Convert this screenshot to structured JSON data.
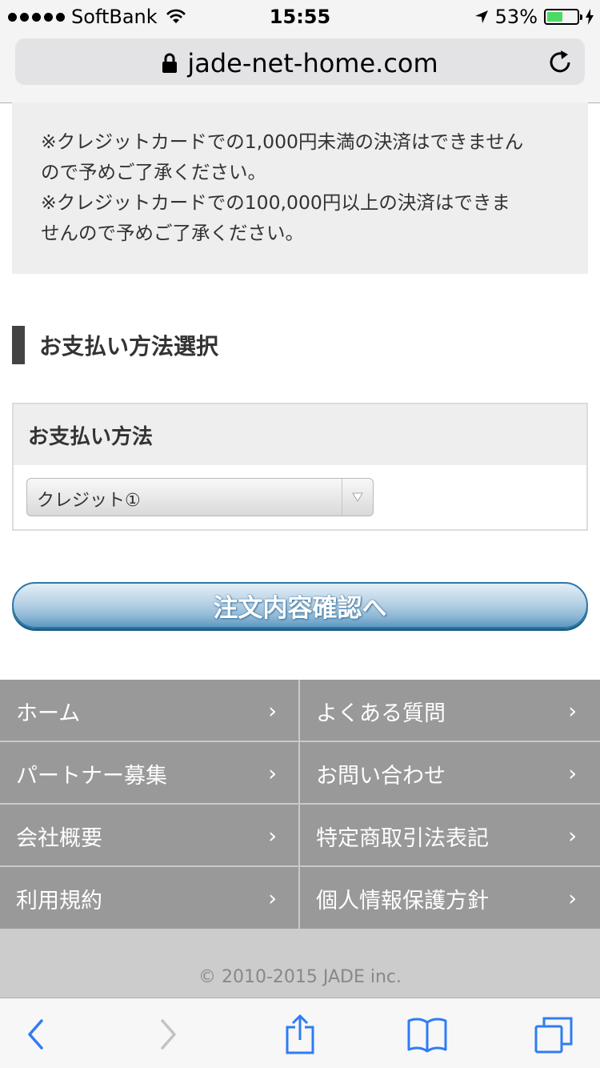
{
  "status_bar": {
    "carrier": "SoftBank",
    "time": "15:55",
    "battery_percent_label": "53%",
    "battery_level": 0.53
  },
  "url_bar": {
    "url": "jade-net-home.com"
  },
  "notice": {
    "line1": "※クレジットカードでの1,000円未満の決済はできません",
    "line2": "ので予めご了承ください。",
    "line3": "※クレジットカードでの100,000円以上の決済はできま",
    "line4": "せんので予めご了承ください。"
  },
  "section": {
    "heading": "お支払い方法選択"
  },
  "payment": {
    "label": "お支払い方法",
    "selected": "クレジット①"
  },
  "confirm_button": {
    "label": "注文内容確認へ",
    "accent": "#2b78a8"
  },
  "footer_nav": {
    "items": [
      {
        "label": "ホーム"
      },
      {
        "label": "よくある質問"
      },
      {
        "label": "パートナー募集"
      },
      {
        "label": "お問い合わせ"
      },
      {
        "label": "会社概要"
      },
      {
        "label": "特定商取引法表記"
      },
      {
        "label": "利用規約"
      },
      {
        "label": "個人情報保護方針"
      }
    ],
    "chevron": "›"
  },
  "footer": {
    "copyright": "© 2010-2015 JADE inc."
  },
  "toolbar": {
    "icons": [
      "back-icon",
      "forward-icon",
      "share-icon",
      "bookmarks-icon",
      "tabs-icon"
    ]
  },
  "colors": {
    "ios_blue": "#2f7cf6",
    "nav_background": "#999999",
    "notice_background": "#eeeeee"
  }
}
